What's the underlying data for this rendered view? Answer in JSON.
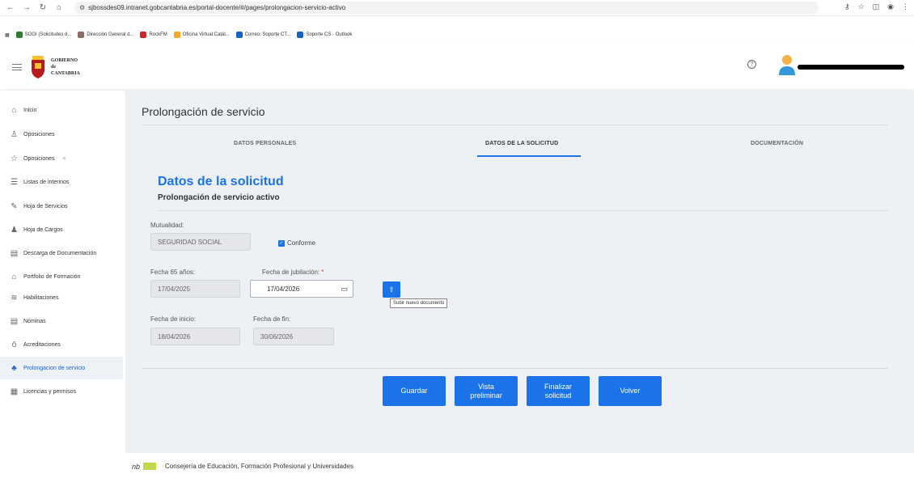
{
  "browser": {
    "url": "sjbossdes09.intranet.gobcantabria.es/portal-docente/#/pages/prolongacion-servicio-activo",
    "bookmarks": [
      {
        "label": "SOGI (Solicitudes d...",
        "color": "#2e7d32"
      },
      {
        "label": "Dirección General d...",
        "color": "#8d6e63"
      },
      {
        "label": "RockFM",
        "color": "#c62828"
      },
      {
        "label": "Oficina Virtual:Catál...",
        "color": "#f9a825"
      },
      {
        "label": "Correo: Soporte CT...",
        "color": "#1565c0"
      },
      {
        "label": "Soporte CS - Outlook",
        "color": "#1565c0"
      }
    ]
  },
  "header": {
    "logo_line1": "GOBIERNO",
    "logo_line2": "de",
    "logo_line3": "CANTABRIA",
    "help_symbol": "?"
  },
  "sidebar": {
    "items": [
      {
        "label": "Inicio",
        "icon": "home-icon",
        "glyph": "⌂"
      },
      {
        "label": "Oposiciones",
        "icon": "person-icon",
        "glyph": "♙"
      },
      {
        "label": "Oposiciones",
        "icon": "star-icon",
        "glyph": "☆",
        "suffix": "<"
      },
      {
        "label": "Listas de interinos",
        "icon": "list-icon",
        "glyph": "☰"
      },
      {
        "label": "Hoja de Servicios",
        "icon": "wrench-icon",
        "glyph": "✎"
      },
      {
        "label": "Hoja de Cargos",
        "icon": "group-icon",
        "glyph": "♟"
      },
      {
        "label": "Descarga de Documentación",
        "icon": "document-icon",
        "glyph": "▤"
      },
      {
        "label": "Portfolio de Formación",
        "icon": "graduation-icon",
        "glyph": "⌂"
      },
      {
        "label": "Habilitaciones",
        "icon": "layers-icon",
        "glyph": "≋"
      },
      {
        "label": "Nóminas",
        "icon": "document-icon",
        "glyph": "▤"
      },
      {
        "label": "Acreditaciones",
        "icon": "medal-icon",
        "glyph": "ö"
      },
      {
        "label": "Prolongacion de servicio",
        "icon": "add-user-icon",
        "glyph": "♣",
        "active": true
      },
      {
        "label": "Licencias y permisos",
        "icon": "calendar-icon",
        "glyph": "▦"
      }
    ]
  },
  "main": {
    "page_title": "Prolongación de servicio",
    "tabs": [
      {
        "label": "DATOS PERSONALES"
      },
      {
        "label": "DATOS DE LA SOLICITUD",
        "active": true
      },
      {
        "label": "DOCUMENTACIÓN"
      }
    ],
    "section_title": "Datos de la solicitud",
    "section_subtitle": "Prolongación de servicio activo",
    "form": {
      "mutualidad_label": "Mutualidad:",
      "mutualidad_value": "SEGURIDAD SOCIAL",
      "conforme_label": "Conforme",
      "conforme_checked": true,
      "fecha65_label": "Fecha 65 años:",
      "fecha65_value": "17/04/2025",
      "jubilacion_label": "Fecha de jubilación:",
      "jubilacion_required": "*",
      "jubilacion_value": "17/04/2026",
      "upload_tooltip": "Subir nuevo documento",
      "inicio_label": "Fecha de inicio:",
      "inicio_value": "18/04/2026",
      "fin_label": "Fecha de fin:",
      "fin_value": "30/06/2026"
    },
    "buttons": {
      "guardar": "Guardar",
      "vista_line1": "Vista",
      "vista_line2": "preliminar",
      "finalizar_line1": "Finalizar",
      "finalizar_line2": "solicitud",
      "volver": "Volver"
    }
  },
  "footer": {
    "text": "Consejería de Educación, Formación Profesional y Universidades"
  }
}
